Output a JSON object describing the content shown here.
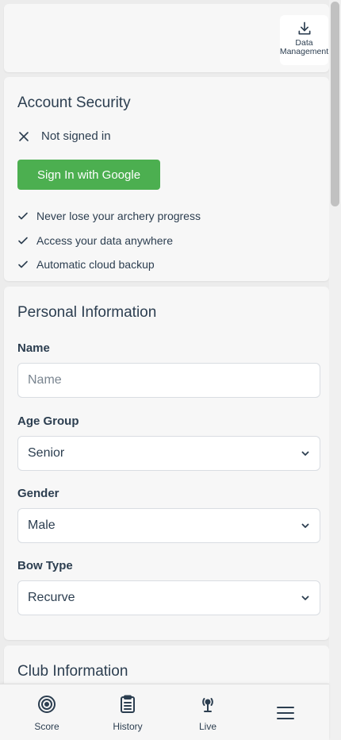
{
  "header": {
    "data_management_label": "Data Management",
    "data_management_icon": "download-icon"
  },
  "security": {
    "title": "Account Security",
    "status_icon": "close-icon",
    "status_text": "Not signed in",
    "sign_in_button": "Sign In with Google",
    "benefits": [
      "Never lose your archery progress",
      "Access your data anywhere",
      "Automatic cloud backup"
    ],
    "accent": "#4caf50"
  },
  "personal": {
    "title": "Personal Information",
    "name_label": "Name",
    "name_value": "",
    "name_placeholder": "Name",
    "age_label": "Age Group",
    "age_value": "Senior",
    "gender_label": "Gender",
    "gender_value": "Male",
    "bow_label": "Bow Type",
    "bow_value": "Recurve"
  },
  "club": {
    "title": "Club Information"
  },
  "nav": {
    "items": [
      {
        "label": "Score",
        "icon": "target-icon"
      },
      {
        "label": "History",
        "icon": "clipboard-icon"
      },
      {
        "label": "Live",
        "icon": "broadcast-icon"
      },
      {
        "label": "",
        "icon": "hamburger-menu-icon"
      }
    ]
  }
}
